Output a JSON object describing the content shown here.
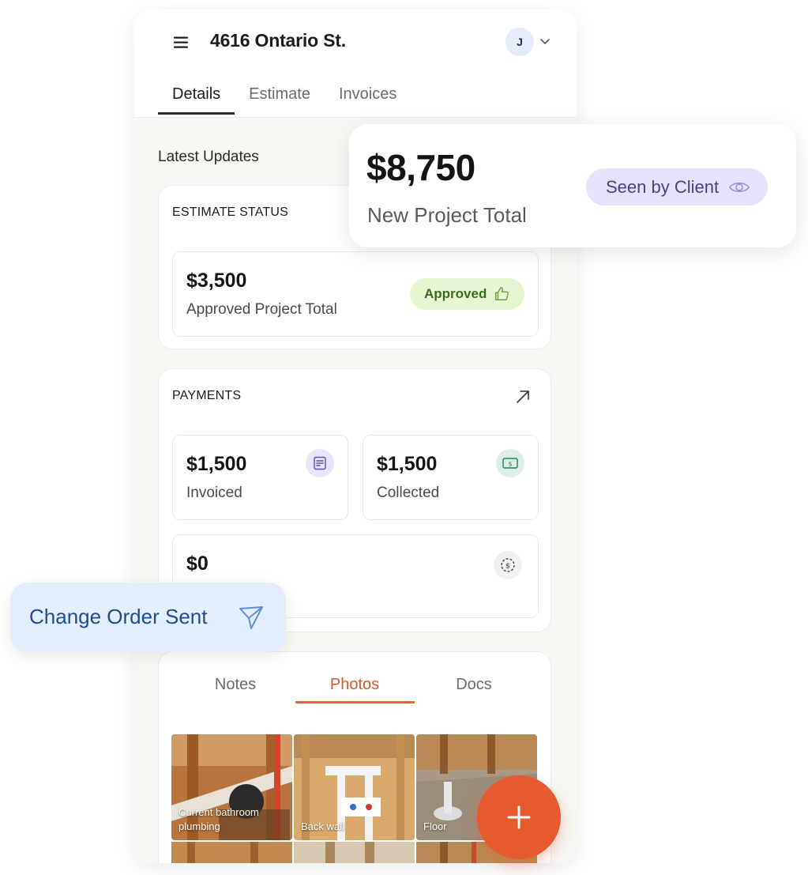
{
  "header": {
    "project_title": "4616 Ontario St.",
    "avatar_initial": "J",
    "menu_icon": "hamburger-icon",
    "dropdown_icon": "chevron-down-icon"
  },
  "tabs": [
    {
      "label": "Details",
      "active": true
    },
    {
      "label": "Estimate",
      "active": false
    },
    {
      "label": "Invoices",
      "active": false
    }
  ],
  "latest_updates_label": "Latest Updates",
  "estimate_status": {
    "title": "ESTIMATE STATUS",
    "amount": "$3,500",
    "subtitle": "Approved Project Total",
    "badge": "Approved",
    "badge_icon": "thumbs-up-icon"
  },
  "payments": {
    "title": "PAYMENTS",
    "expand_icon": "arrow-up-right-icon",
    "invoiced": {
      "amount": "$1,500",
      "label": "Invoiced",
      "icon": "invoice-icon"
    },
    "collected": {
      "amount": "$1,500",
      "label": "Collected",
      "icon": "cash-icon"
    },
    "remaining": {
      "amount": "$0",
      "icon": "dollar-cycle-icon"
    }
  },
  "media_tabs": [
    {
      "label": "Notes",
      "active": false
    },
    {
      "label": "Photos",
      "active": true
    },
    {
      "label": "Docs",
      "active": false
    }
  ],
  "photos": [
    {
      "caption_line1": "Current bathroom",
      "caption_line2": "plumbing"
    },
    {
      "caption_line1": "Back wall",
      "caption_line2": ""
    },
    {
      "caption_line1": "Floor",
      "caption_line2": ""
    }
  ],
  "fab": {
    "icon": "plus-icon"
  },
  "float_total": {
    "amount": "$8,750",
    "subtitle": "New Project Total",
    "badge": "Seen by Client",
    "badge_icon": "eye-icon"
  },
  "float_change": {
    "label": "Change Order Sent",
    "icon": "send-icon"
  },
  "colors": {
    "accent_orange": "#e65a2e",
    "approved_bg": "#e7f5d3",
    "seen_bg": "#e7e1fb",
    "change_bg": "#e3eefc"
  }
}
